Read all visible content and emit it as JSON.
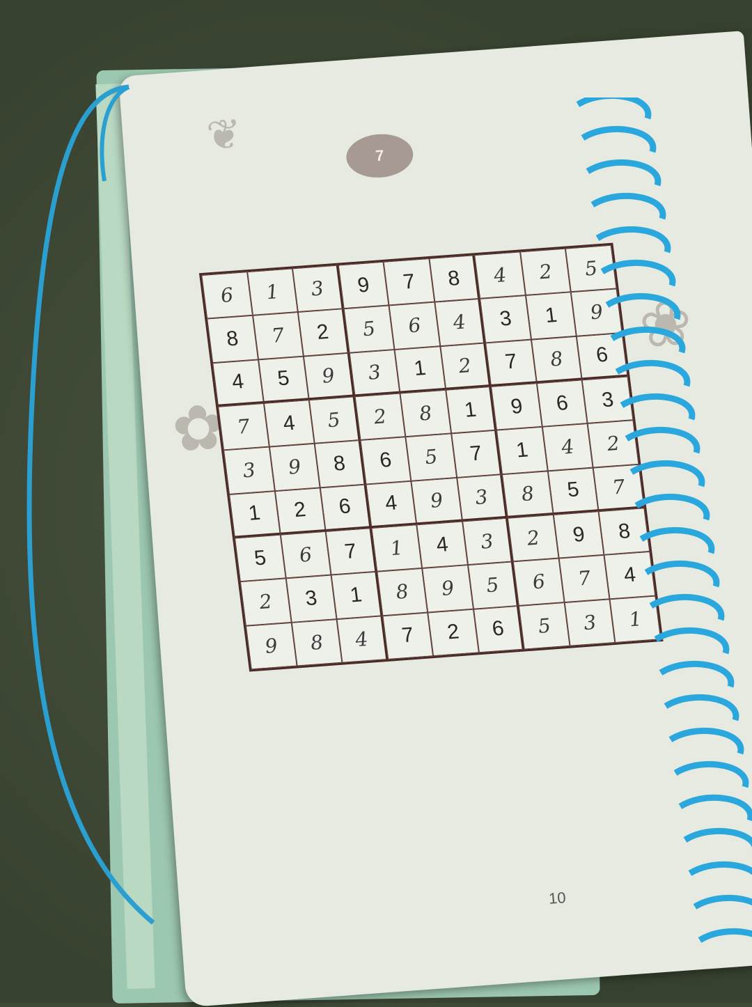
{
  "puzzle_number": "7",
  "page_number": "10",
  "grid": [
    [
      "6",
      "1",
      "3",
      "9",
      "7",
      "8",
      "4",
      "2",
      "5"
    ],
    [
      "8",
      "7",
      "2",
      "5",
      "6",
      "4",
      "3",
      "1",
      "9"
    ],
    [
      "4",
      "5",
      "9",
      "3",
      "1",
      "2",
      "7",
      "8",
      "6"
    ],
    [
      "7",
      "4",
      "5",
      "2",
      "8",
      "1",
      "9",
      "6",
      "3"
    ],
    [
      "3",
      "9",
      "8",
      "6",
      "5",
      "7",
      "1",
      "4",
      "2"
    ],
    [
      "1",
      "2",
      "6",
      "4",
      "9",
      "3",
      "8",
      "5",
      "7"
    ],
    [
      "5",
      "6",
      "7",
      "1",
      "4",
      "3",
      "2",
      "9",
      "8"
    ],
    [
      "2",
      "3",
      "1",
      "8",
      "9",
      "5",
      "6",
      "7",
      "4"
    ],
    [
      "9",
      "8",
      "4",
      "7",
      "2",
      "6",
      "5",
      "3",
      "1"
    ]
  ],
  "given": [
    [
      0,
      0,
      0,
      1,
      1,
      1,
      0,
      0,
      0
    ],
    [
      1,
      0,
      1,
      0,
      0,
      0,
      1,
      1,
      0
    ],
    [
      1,
      1,
      0,
      0,
      1,
      0,
      1,
      0,
      1
    ],
    [
      0,
      1,
      0,
      0,
      0,
      1,
      1,
      1,
      1
    ],
    [
      0,
      0,
      1,
      1,
      0,
      1,
      1,
      0,
      0
    ],
    [
      1,
      1,
      1,
      1,
      0,
      0,
      0,
      1,
      0
    ],
    [
      1,
      0,
      1,
      0,
      1,
      0,
      0,
      1,
      1
    ],
    [
      0,
      1,
      1,
      0,
      0,
      0,
      0,
      0,
      1
    ],
    [
      0,
      0,
      0,
      1,
      1,
      1,
      0,
      0,
      0
    ]
  ],
  "colors": {
    "background": "#3f4a36",
    "page": "#e6eae0",
    "grid_line": "#4a2a26",
    "spiral": "#2aa8de",
    "badge": "#a69a92"
  }
}
